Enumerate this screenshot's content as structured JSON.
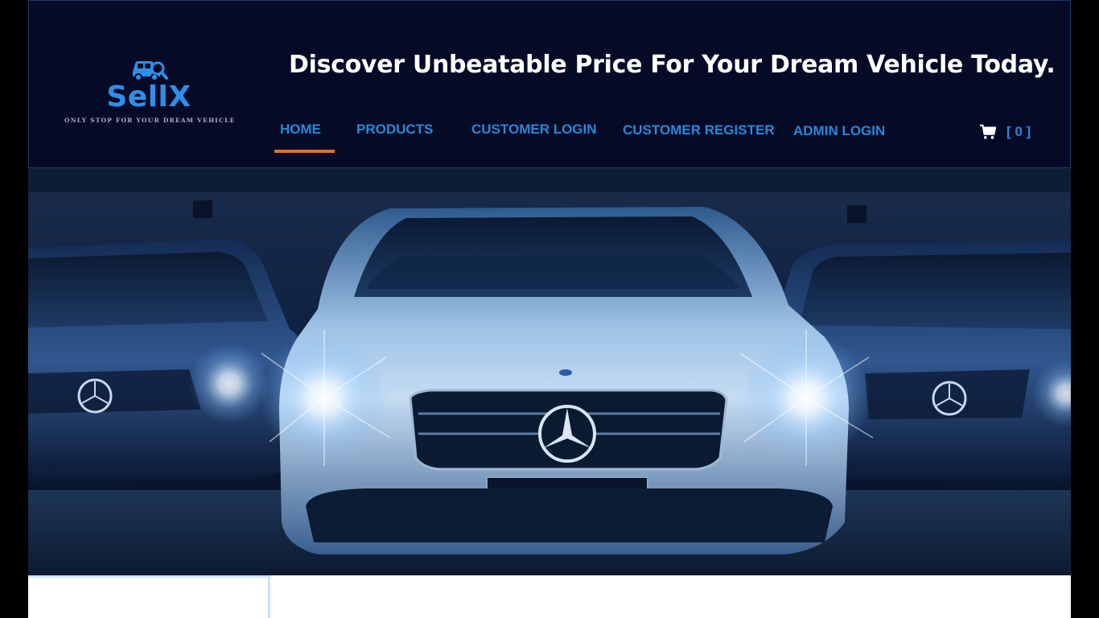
{
  "brand": {
    "name": "SellX",
    "tagline": "ONLY STOP FOR YOUR DREAM VEHICLE",
    "logo_icon": "car-search-icon",
    "color": "#2f8fe8"
  },
  "header": {
    "headline": "Discover Unbeatable Price For Your Dream Vehicle Today."
  },
  "nav": {
    "items": [
      {
        "label": "HOME",
        "active": true
      },
      {
        "label": "PRODUCTS"
      },
      {
        "label": "CUSTOMER LOGIN"
      },
      {
        "label": "CUSTOMER REGISTER"
      },
      {
        "label": "ADMIN LOGIN"
      }
    ],
    "active_color": "#e8701c",
    "link_color": "#2a88d8"
  },
  "cart": {
    "icon": "cart-icon",
    "count_text": "[ 0 ]"
  },
  "hero": {
    "image": "hero-cars-photo"
  },
  "colors": {
    "header_bg": "#050a26",
    "page_bg": "#000000"
  }
}
